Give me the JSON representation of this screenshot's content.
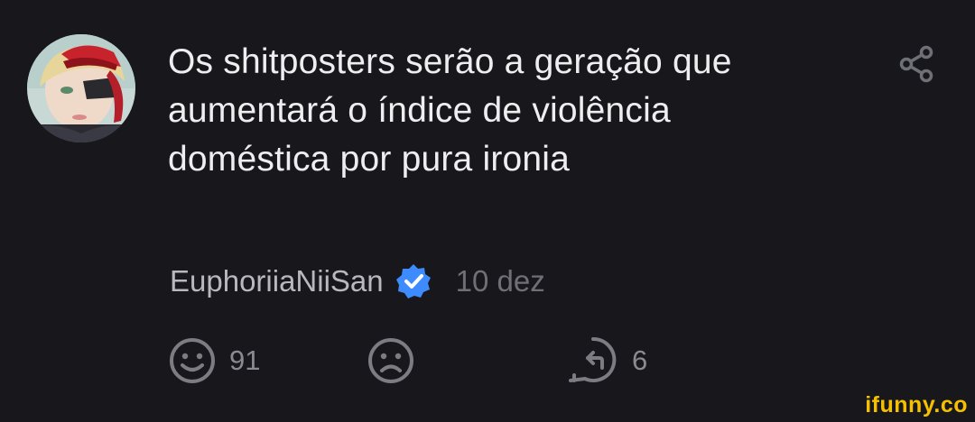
{
  "comment": {
    "text": "Os shitposters serão a geração que aumentará o índice de violência doméstica por pura ironia",
    "author": "EuphoriiaNiiSan",
    "date": "10 dez",
    "verified": true
  },
  "actions": {
    "smile_count": "91",
    "reply_count": "6"
  },
  "icons": {
    "share": "share-icon",
    "verified": "verified-badge-icon",
    "smile": "smile-icon",
    "frown": "frown-icon",
    "reply": "reply-icon"
  },
  "colors": {
    "background": "#18181c",
    "text": "#eeeef0",
    "username": "#b8b8be",
    "muted": "#6f6f76",
    "verified": "#3d8bfd",
    "watermark": "#f5c000"
  },
  "watermark": "ifunny.co"
}
